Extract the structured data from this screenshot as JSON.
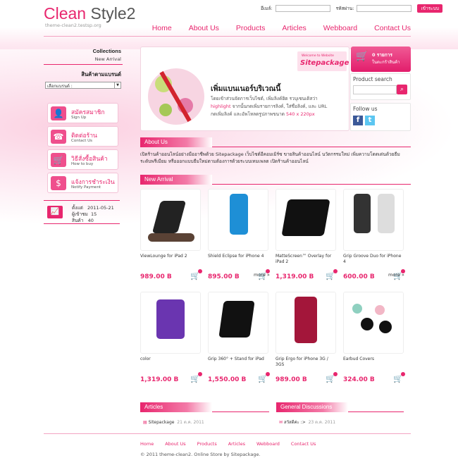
{
  "header": {
    "logo_a": "Clean",
    "logo_b": " Style2",
    "logo_sub": "theme-clean2.testsp.org",
    "email_label": "อีเมล์:",
    "password_label": "รหัสผ่าน:",
    "login_btn": "เข้าระบบ",
    "nav": [
      "Home",
      "About Us",
      "Products",
      "Articles",
      "Webboard",
      "Contact Us"
    ]
  },
  "sidebar": {
    "collections": "Collections",
    "new_arrival": "New Arrival",
    "brand_title": "สินค้าตามแบรนด์",
    "brand_select": "เลือกแบรนด์ :",
    "buttons": [
      {
        "th": "สมัครสมาชิก",
        "en": "Sign Up",
        "icon": "user-icon"
      },
      {
        "th": "ติดต่อร้าน",
        "en": "Contact Us",
        "icon": "phone-icon"
      },
      {
        "th": "วิธีสั่งซื้อสินค้า",
        "en": "How to buy",
        "icon": "cart-icon"
      },
      {
        "th": "แจ้งการชำระเงิน",
        "en": "Notify Payment",
        "icon": "money-icon"
      }
    ],
    "stats": {
      "created_label": "ตั้งแต่",
      "created": "2011-05-21",
      "visitors_label": "ผู้เข้าชม",
      "visitors": "15",
      "products_label": "สินค้า",
      "products": "40"
    }
  },
  "banner": {
    "title": "เพิ่มแบนเนอร์บริเวณนี้",
    "line1": "โดยเข้าส่วนจัดการเว็บไซต์, เพิ่มลิงค์ฮิต รวบุเซนเดิสว่า",
    "line2_a": "highlight",
    "line2_b": " จากนั้นกดเพิ่มรายการลิงค์, ใส่ชื่อลิงค์, และ URL",
    "line3_a": "กดเพิ่มลิงค์ และอัพโหลดรูปภาพขนาด ",
    "line3_b": "540 x 220px",
    "sp_small": "Welcome to Website",
    "sp_brand": "Sitepackage",
    "colors": {
      "accent": "#e8266e"
    }
  },
  "cart": {
    "count_label": "0 รายการ",
    "sub": "ในตะกร้าสินค้า"
  },
  "search": {
    "title": "Product search",
    "placeholder": ""
  },
  "follow": {
    "title": "Follow us"
  },
  "about": {
    "title": "About Us",
    "text": "เปิดร้านค้าออนไลน์อย่างมืออาชีพด้วย Sitepackage เว็บไซต์อีคอมเมิร์ซ ขายสินค้าออนไลน์ นวัตกรรมใหม่ เพิ่มความโดดเด่นด้วยธีม ระดับพรีเมียม หรือออกแบบธีมใหม่ตามต้องการด้วยระบบเทมเพลต เปิดร้านค้าออนไลน์"
  },
  "new_arrival": {
    "title": "New Arrival",
    "more": "more »",
    "products": [
      {
        "name": "ViewLounge for iPad 2",
        "price": "989.00 B"
      },
      {
        "name": "Shield Eclipse for iPhone 4",
        "price": "895.00 B"
      },
      {
        "name": "MatteScreen™ Overlay for iPad 2",
        "price": "1,319.00 B"
      },
      {
        "name": "Grip Groove Duo for iPhone 4",
        "price": "600.00 B"
      },
      {
        "name": "color",
        "price": "1,319.00 B"
      },
      {
        "name": "Grip 360° + Stand for iPad",
        "price": "1,550.00 B"
      },
      {
        "name": "Grip Ergo for iPhone 3G / 3GS",
        "price": "989.00 B"
      },
      {
        "name": "Earbud Covers",
        "price": "324.00 B"
      }
    ]
  },
  "articles": {
    "title": "Articles",
    "item": "Sitepackage",
    "date": "21 ต.ค. 2011"
  },
  "discussions": {
    "title": "General Discussions",
    "item": "สวัสดีค่ะ :>",
    "date": "23 ต.ค. 2011"
  },
  "footer": {
    "nav": [
      "Home",
      "About Us",
      "Products",
      "Articles",
      "Webboard",
      "Contact Us"
    ],
    "copyright": "© 2011 theme-clean2. Online Store by Sitepackage."
  }
}
